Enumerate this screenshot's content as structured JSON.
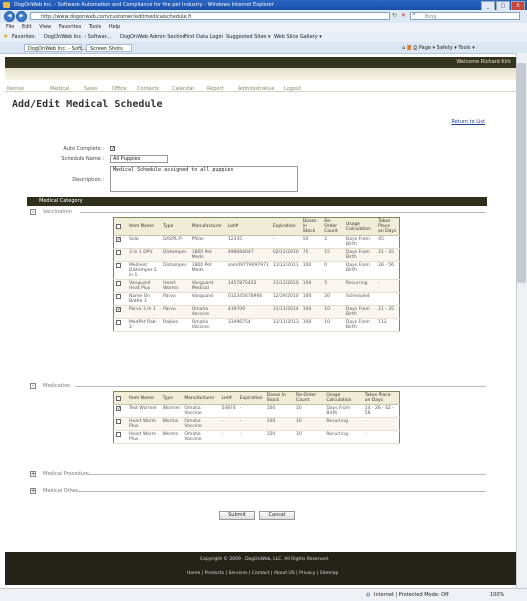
{
  "window": {
    "title": "DogOnWeb Inc. - Software Automation and Compliance for the pet Industry - Windows Internet Explorer",
    "buttons": [
      "_",
      "□",
      "X"
    ]
  },
  "browser": {
    "url": "http://www.dogonweb.com/customer/editmedicalschedule.fi",
    "search_placeholder": "Bing",
    "menu": [
      "File",
      "Edit",
      "View",
      "Favorites",
      "Tools",
      "Help"
    ],
    "favorites_label": "Favorites",
    "favorites": [
      "DogOnWeb Inc. - Softwar...",
      "DogOnWeb Admin Section",
      "First Data Login",
      "Suggested Sites ▾",
      "Web Slice Gallery ▾"
    ],
    "tabs": [
      "DogOnWeb Inc. - Soft...",
      "Screen Shots"
    ],
    "command_bar": [
      "Page ▾",
      "Safety ▾",
      "Tools ▾"
    ],
    "status_zone": "Internet | Protected Mode: Off",
    "zoom": "100%"
  },
  "site": {
    "welcome": "Welcome Richard Kirk",
    "nav": [
      "Kennel",
      "Medical",
      "Sales",
      "Office",
      "Contacts",
      "Calendar",
      "Report",
      "Administrative",
      "Logout"
    ]
  },
  "form": {
    "page_title": "Add/Edit Medical Schedule",
    "return_link": "Return to List",
    "auto_complete_label": "Auto Complete :",
    "auto_complete_checked": true,
    "schedule_name_label": "Schedule Name :",
    "schedule_name_value": "All Puppies",
    "description_label": "Description :",
    "description_value": "Medical Schedule assigned to all puppies",
    "category_header": "Medical Category",
    "submit_label": "Submit",
    "cancel_label": "Cancel"
  },
  "vaccination": {
    "title": "Vaccination",
    "toggle": "-",
    "columns": [
      "Item Name",
      "Type",
      "Manufacturer",
      "Lot#",
      "Expiration",
      "Doses In Stock",
      "Re-Order Count",
      "Usage Calculation",
      "Takes Place on Days"
    ],
    "rows": [
      {
        "checked": true,
        "name": "Sear",
        "type": "DA2PL-P",
        "mfr": "Pfizer",
        "lot": "12345",
        "exp": "-",
        "doses": "50",
        "reorder": "2",
        "usage": "Days From Birth",
        "days": "45"
      },
      {
        "checked": false,
        "name": "3 In 1 DPV",
        "type": "Distemper",
        "mfr": "1800 Pet Meds",
        "lot": "498684047",
        "exp": "02/12/2010",
        "doses": "75",
        "reorder": "15",
        "usage": "Days From Birth",
        "days": "21 - 35"
      },
      {
        "checked": false,
        "name": "Medivet Distemper 2 in 1",
        "type": "Distemper",
        "mfr": "1800 Pet Meds",
        "lot": "sam09779097971",
        "exp": "11/12/2011",
        "doses": "100",
        "reorder": "0",
        "usage": "Days From Birth",
        "days": "28 - 56"
      },
      {
        "checked": false,
        "name": "Vanguard Heat Plus",
        "type": "Heart Worms",
        "mfr": "Vanguard Medical",
        "lot": "1457875422",
        "exp": "11/11/2010",
        "doses": "100",
        "reorder": "5",
        "usage": "Recurring",
        "days": "-"
      },
      {
        "checked": false,
        "name": "Name On Bottle 3",
        "type": "Parvo",
        "mfr": "Vanguard",
        "lot": "012345678966",
        "exp": "12/29/2010",
        "doses": "100",
        "reorder": "20",
        "usage": "Scheduled",
        "days": ""
      },
      {
        "checked": true,
        "name": "Parvo 3 In 1",
        "type": "Parvo",
        "mfr": "Omaha Vaccine",
        "lot": "439709",
        "exp": "11/11/2014",
        "doses": "100",
        "reorder": "10",
        "usage": "Days From Birth",
        "days": "21 - 35"
      },
      {
        "checked": false,
        "name": "MedPet Rab-3",
        "type": "Rabies",
        "mfr": "Omaha Vaccine",
        "lot": "33496754",
        "exp": "11/11/2013",
        "doses": "100",
        "reorder": "10",
        "usage": "Days From Birth",
        "days": "112"
      }
    ]
  },
  "medication": {
    "title": "Medication",
    "toggle": "-",
    "columns": [
      "Item Name",
      "Type",
      "Manufacturer",
      "Lot#",
      "Expiration",
      "Doses In Stock",
      "Re-Order Count",
      "Usage Calculation",
      "Takes Place on Days"
    ],
    "rows": [
      {
        "checked": true,
        "name": "Test Wormer",
        "type": "Wormer",
        "mfr": "Omaha Vaccine",
        "lot": "54874",
        "exp": "-",
        "doses": "100",
        "reorder": "10",
        "usage": "Days From Birth",
        "days": "14 - 28 - 42 - 56"
      },
      {
        "checked": false,
        "name": "Heart Worm Plus",
        "type": "Worms",
        "mfr": "Omaha Vaccine",
        "lot": "-",
        "exp": "-",
        "doses": "100",
        "reorder": "10",
        "usage": "Recurring",
        "days": "-"
      },
      {
        "checked": false,
        "name": "Heart Worm Plus",
        "type": "Worms",
        "mfr": "Omaha Vaccine",
        "lot": "-",
        "exp": "-",
        "doses": "150",
        "reorder": "10",
        "usage": "Recurring",
        "days": "-"
      }
    ]
  },
  "collapsed_sections": [
    {
      "title": "Medical Procedure",
      "toggle": "+"
    },
    {
      "title": "Medical Other",
      "toggle": "+"
    }
  ],
  "footer": {
    "copyright": "Copyright © 2009 . DogOnWeb, LLC. All Rights Reserved.",
    "links": [
      "Home",
      "Products",
      "Services",
      "Contact",
      "About US",
      "Privacy",
      "Sitemap"
    ]
  }
}
